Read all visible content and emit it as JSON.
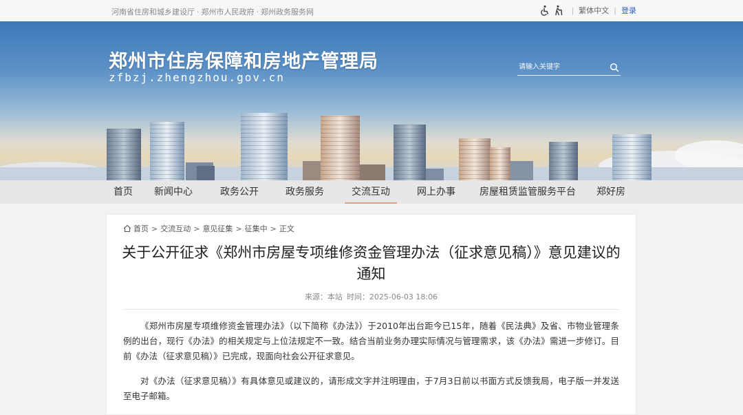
{
  "topbar": {
    "links": [
      "河南省住房和城乡建设厅",
      "郑州市人民政府",
      "郑州政务服务网"
    ],
    "separator": "·",
    "traditional": "繁体中文",
    "divider": "|",
    "login": "登录"
  },
  "banner": {
    "title": "郑州市住房保障和房地产管理局",
    "domain": "zfbzj.zhengzhou.gov.cn",
    "search_placeholder": "请输入关键字"
  },
  "nav": {
    "items": [
      "首页",
      "新闻中心",
      "政务公开",
      "政务服务",
      "交流互动",
      "网上办事",
      "房屋租赁监管服务平台",
      "郑好房"
    ],
    "active": "交流互动"
  },
  "breadcrumb": {
    "items": [
      "首页",
      "交流互动",
      "意见征集",
      "征集中",
      "正文"
    ],
    "separator": ">"
  },
  "article": {
    "title": "关于公开征求《郑州市房屋专项维修资金管理办法（征求意见稿）》意见建议的通知",
    "source_label": "来源：本站",
    "time_label": "时间：2025-06-03 18:06",
    "paragraphs": [
      "《郑州市房屋专项维修资金管理办法》（以下简称《办法》）于2010年出台距今已15年，随着《民法典》及省、市物业管理条例的出台，现行《办法》的相关规定与上位法规定不一致。结合当前业务办理实际情况与管理需求，该《办法》需进一步修订。目前《办法（征求意见稿）》已完成，现面向社会公开征求意见。",
      "对《办法（征求意见稿）》有具体意见或建议的，请形成文字并注明理由，于7月3日前以书面方式反馈我局，电子版一并发送至电子邮箱。"
    ]
  },
  "icons": [
    "accessibility-icon",
    "elderly-icon",
    "search-icon",
    "home-icon"
  ],
  "colors": {
    "nav_active_underline": "#e9a07a",
    "login_link": "#2a62b5"
  }
}
